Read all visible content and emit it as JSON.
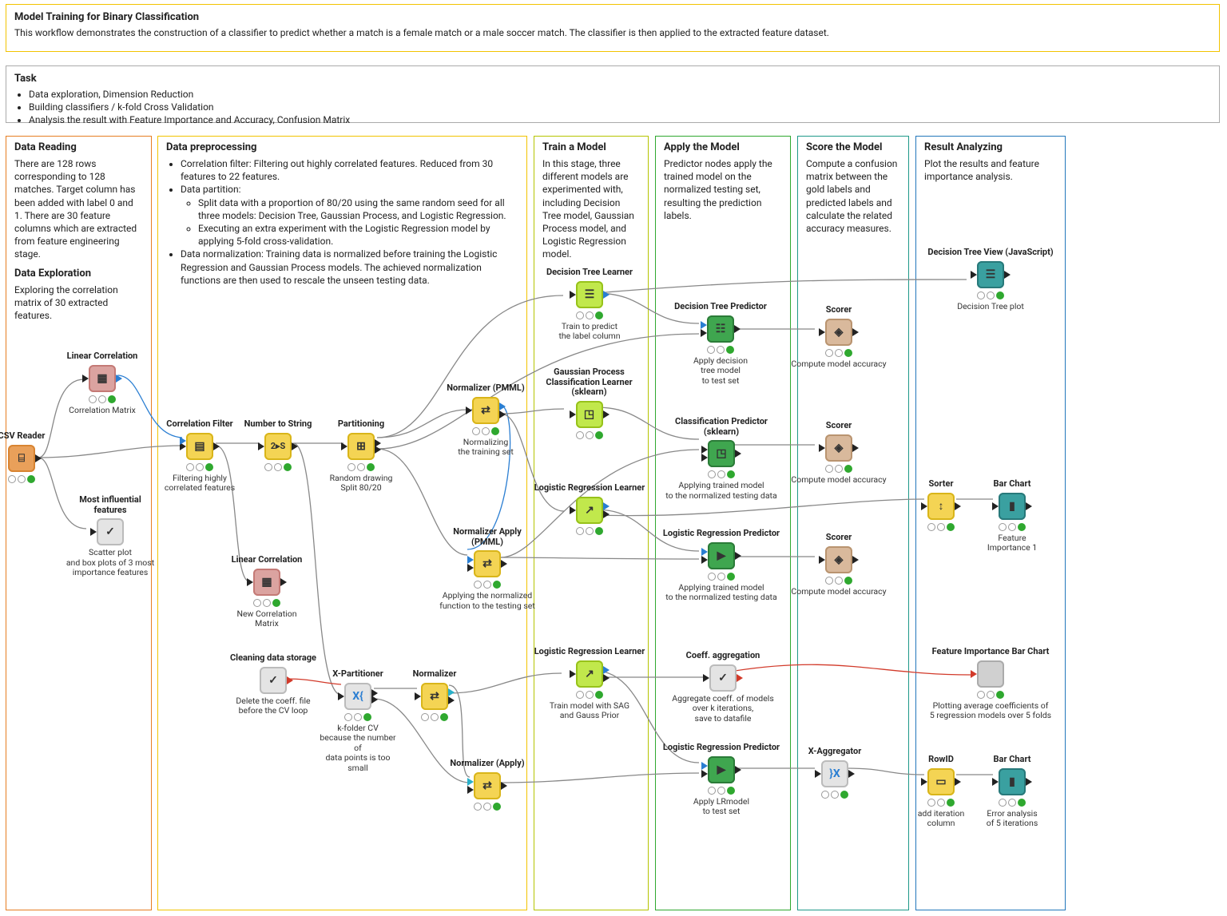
{
  "header_anno": {
    "title": "Model Training for Binary Classification",
    "text": "This workflow demonstrates the construction of a classifier to predict whether a match is a female match or a male soccer match. The classifier is then applied to the extracted feature dataset."
  },
  "task": {
    "title": "Task",
    "items": [
      "Data exploration, Dimension Reduction",
      "Building classifiers / k-fold Cross Validation",
      "Analysis the result with Feature Importance and Accuracy, Confusion Matrix"
    ]
  },
  "sections": {
    "data_reading": {
      "title1": "Data Reading",
      "text1": "There are 128 rows corresponding to 128 matches. Target column has been added with label 0 and 1. There are 30 feature columns which are extracted from feature engineering stage.",
      "title2": "Data Exploration",
      "text2": "Exploring the correlation matrix of 30 extracted features."
    },
    "preproc": {
      "title": "Data preprocessing",
      "b1": "Correlation filter: Filtering out highly correlated features. Reduced from 30 features to 22 features.",
      "b2": "Data partition:",
      "b2a": "Split data with a proportion of 80/20 using the same random seed for all three models: Decision Tree, Gaussian Process, and Logistic Regression.",
      "b2b": "Executing an extra experiment with the Logistic Regression model by applying 5-fold cross-validation.",
      "b3": "Data normalization: Training data is normalized before training the Logistic Regression and Gaussian Process models. The achieved normalization functions are then used to rescale the unseen testing data."
    },
    "train": {
      "title": "Train a Model",
      "text": "In this stage, three different models are experimented with, including Decision Tree model, Gaussian Process model, and Logistic Regression model."
    },
    "apply": {
      "title": "Apply the Model",
      "text": "Predictor nodes apply the trained model on the normalized testing set, resulting the prediction labels."
    },
    "score": {
      "title": "Score the Model",
      "text": "Compute a confusion matrix between the gold labels and predicted labels and calculate the related accuracy measures."
    },
    "result": {
      "title": "Result Analyzing",
      "text": "Plot the results and feature importance analysis."
    }
  },
  "nodes": {
    "csv": {
      "title": "CSV Reader",
      "caption": "",
      "glyph": "⌸"
    },
    "lincorr1": {
      "title": "Linear Correlation",
      "caption": "Correlation Matrix",
      "glyph": "▦"
    },
    "mif": {
      "title": "Most influential features",
      "caption": "Scatter plot\nand box plots of 3 most\nimportance features",
      "glyph": "✓"
    },
    "corrfilt": {
      "title": "Correlation Filter",
      "caption": "Filtering highly\ncorrelated features",
      "glyph": "▤"
    },
    "num2str": {
      "title": "Number to String",
      "caption": "",
      "glyph": "2▸S"
    },
    "part": {
      "title": "Partitioning",
      "caption": "Random drawing\nSplit 80/20",
      "glyph": "⊞"
    },
    "lincorr2": {
      "title": "Linear Correlation",
      "caption": "New Correlation Matrix",
      "glyph": "▦"
    },
    "normP": {
      "title": "Normalizer (PMML)",
      "caption": "Normalizing\nthe training set",
      "glyph": "⇄"
    },
    "normAP": {
      "title": "Normalizer Apply (PMML)",
      "caption": "Applying the normalized\nfunction to the  testing set",
      "glyph": "⇄"
    },
    "clean": {
      "title": "Cleaning data storage",
      "caption": "Delete the coeff. file\nbefore the CV loop",
      "glyph": "✓"
    },
    "xpart": {
      "title": "X-Partitioner",
      "caption": "k-folder CV\nbecause the number of\ndata points is too small",
      "glyph": "X{"
    },
    "norm2": {
      "title": "Normalizer",
      "caption": "",
      "glyph": "⇄"
    },
    "normA2": {
      "title": "Normalizer (Apply)",
      "caption": "",
      "glyph": "⇄"
    },
    "dtL": {
      "title": "Decision Tree Learner",
      "caption": "Train to predict\nthe label column",
      "glyph": "☰"
    },
    "gpL": {
      "title": "Gaussian Process Classification Learner (sklearn)",
      "caption": "",
      "glyph": "◳"
    },
    "lrL": {
      "title": "Logistic Regression Learner",
      "caption": "",
      "glyph": "↗"
    },
    "lrL2": {
      "title": "Logistic Regression Learner",
      "caption": "Train model with SAG\nand Gauss Prior",
      "glyph": "↗"
    },
    "dtP": {
      "title": "Decision Tree Predictor",
      "caption": "Apply decision\ntree model\nto test set",
      "glyph": "☷"
    },
    "clP": {
      "title": "Classification Predictor (sklearn)",
      "caption": "Applying trained model\nto the normalized testing data",
      "glyph": "◳"
    },
    "lrP": {
      "title": "Logistic Regression Predictor",
      "caption": "Applying trained model\nto the normalized testing data",
      "glyph": "▶"
    },
    "lrP2": {
      "title": "Logistic Regression Predictor",
      "caption": "Apply LRmodel\nto test set",
      "glyph": "▶"
    },
    "coef": {
      "title": "Coeff. aggregation",
      "caption": "Aggregate coeff. of models\nover k iterations,\nsave to datafile",
      "glyph": "✓"
    },
    "scorer1": {
      "title": "Scorer",
      "caption": "Compute model accuracy",
      "glyph": "◈"
    },
    "scorer2": {
      "title": "Scorer",
      "caption": "Compute model accuracy",
      "glyph": "◈"
    },
    "scorer3": {
      "title": "Scorer",
      "caption": "Compute model accuracy",
      "glyph": "◈"
    },
    "xagg": {
      "title": "X-Aggregator",
      "caption": "",
      "glyph": "}X"
    },
    "dtView": {
      "title": "Decision Tree View (JavaScript)",
      "caption": "Decision Tree plot",
      "glyph": "☰"
    },
    "sorter": {
      "title": "Sorter",
      "caption": "",
      "glyph": "↕"
    },
    "bar1": {
      "title": "Bar Chart",
      "caption": "Feature Importance 1",
      "glyph": "▮"
    },
    "fibar": {
      "title": "Feature Importance Bar Chart",
      "caption": "Plotting average coefficients of\n5 regression models over 5 folds",
      "glyph": ""
    },
    "rowid": {
      "title": "RowID",
      "caption": "add iteration\ncolumn",
      "glyph": "▭"
    },
    "bar2": {
      "title": "Bar Chart",
      "caption": "Error analysis\nof 5 iterations",
      "glyph": "▮"
    }
  },
  "row_labels": {
    "row1_title": "",
    "note_extra": ""
  }
}
